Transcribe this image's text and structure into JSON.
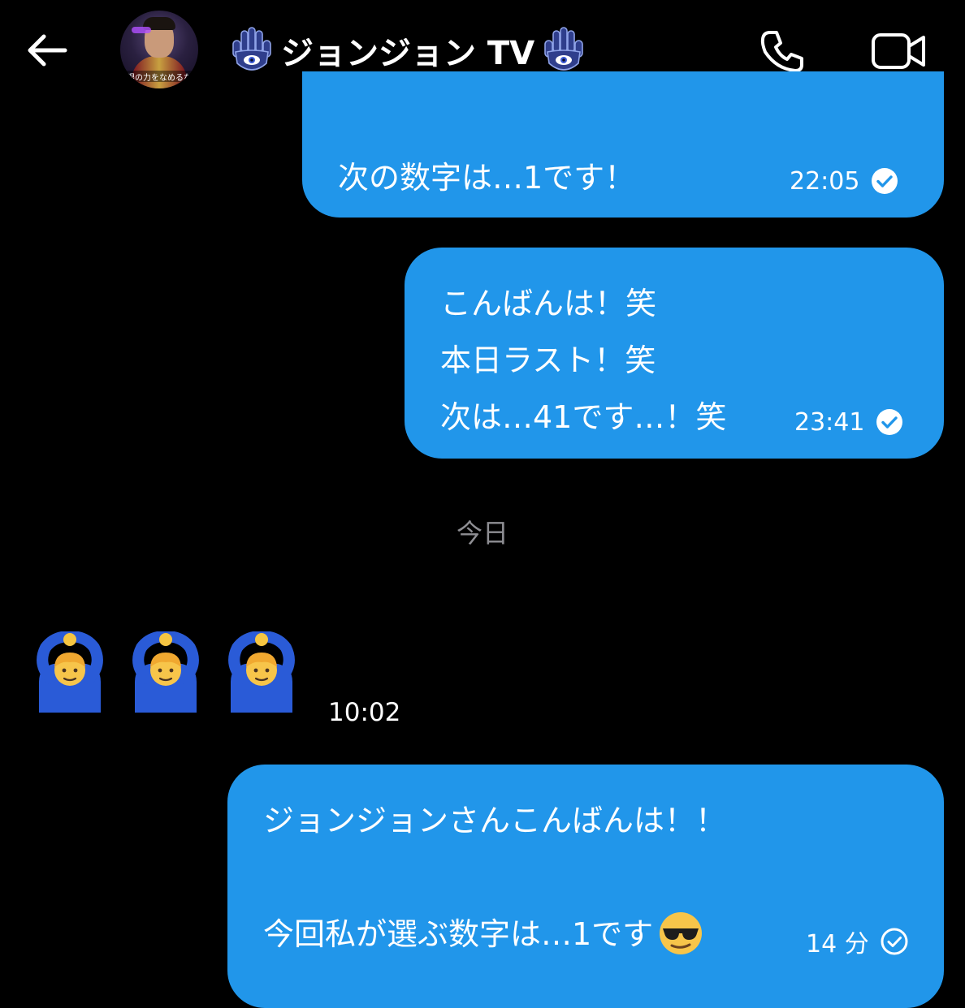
{
  "header": {
    "title": "ジョンジョン TV",
    "avatar_banner": "邪眼の力をなめるなよ",
    "icons": {
      "back": "arrow-left-icon",
      "title_left": "hamsa-hand-icon",
      "title_right": "hamsa-hand-icon",
      "call": "phone-icon",
      "video": "video-camera-icon"
    }
  },
  "messages": [
    {
      "direction": "sent",
      "lines": [
        "次の数字は…1です！"
      ],
      "time": "22:05",
      "status": "check-circle-icon"
    },
    {
      "direction": "sent",
      "lines": [
        "こんばんは！笑",
        "本日ラスト！笑",
        "次は…41です…！笑"
      ],
      "time": "23:41",
      "status": "check-circle-icon"
    },
    {
      "direction": "received",
      "emoji": [
        "person-gesturing-ok-icon",
        "person-gesturing-ok-icon",
        "person-gesturing-ok-icon"
      ],
      "time": "10:02"
    },
    {
      "direction": "sent",
      "lines": [
        "ジョンジョンさんこんばんは！！",
        "",
        "今回私が選ぶ数字は…1です"
      ],
      "trailing_emoji": "sunglasses-face-icon",
      "time": "14 分",
      "status": "check-circle-outline-icon"
    }
  ],
  "date_separator": "今日",
  "colors": {
    "background": "#000000",
    "bubble_sent": "#2196ea",
    "date_text": "#8e8e93"
  }
}
